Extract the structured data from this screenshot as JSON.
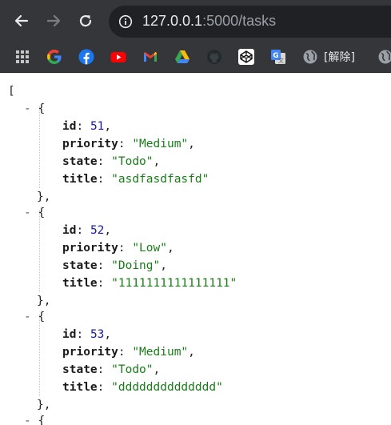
{
  "browser": {
    "url_host": "127.0.0.1",
    "url_rest": ":5000/tasks",
    "bookmarks": [
      {
        "icon": "apps-grid-icon"
      },
      {
        "icon": "google-icon"
      },
      {
        "icon": "facebook-icon"
      },
      {
        "icon": "youtube-icon"
      },
      {
        "icon": "gmail-icon"
      },
      {
        "icon": "google-drive-icon"
      },
      {
        "icon": "github-icon"
      },
      {
        "icon": "codepen-icon"
      },
      {
        "icon": "google-translate-icon"
      },
      {
        "icon": "globe-icon",
        "label": "[解除]"
      },
      {
        "icon": "globe-icon"
      }
    ]
  },
  "json": {
    "open_bracket": "[",
    "tasks": [
      {
        "id": "51",
        "priority": "\"Medium\"",
        "state": "\"Todo\"",
        "title": "\"asdfasdfasfd\""
      },
      {
        "id": "52",
        "priority": "\"Low\"",
        "state": "\"Doing\"",
        "title": "\"1111111111111111\""
      },
      {
        "id": "53",
        "priority": "\"Medium\"",
        "state": "\"Todo\"",
        "title": "\"dddddddddddddd\""
      }
    ],
    "keys": {
      "id": "id",
      "priority": "priority",
      "state": "state",
      "title": "title"
    }
  },
  "colors": {
    "toolbar": "#35363a",
    "omnibox": "#202124",
    "json_string": "#1c7a1c",
    "json_number": "#1a1aa6"
  }
}
